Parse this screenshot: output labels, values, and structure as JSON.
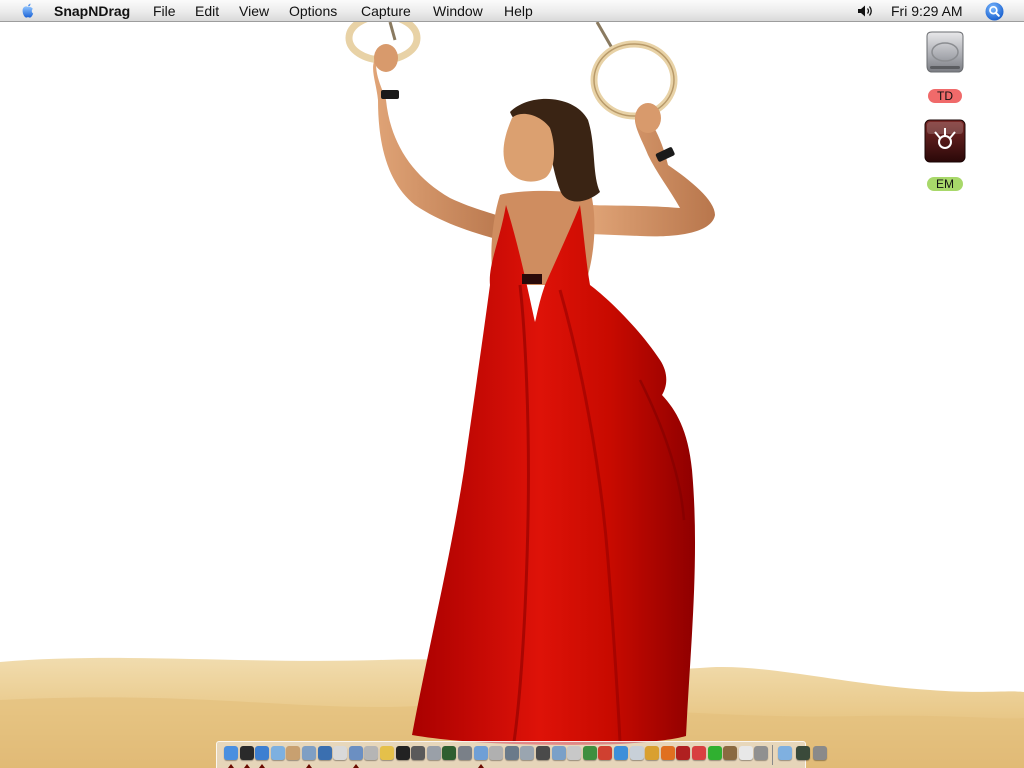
{
  "menubar": {
    "app_name": "SnapNDrag",
    "items": [
      "File",
      "Edit",
      "View",
      "Options",
      "Capture",
      "Window",
      "Help"
    ],
    "clock": "Fri 9:29 AM"
  },
  "desktop": {
    "icons": [
      {
        "label": "TD",
        "kind": "hard-drive",
        "label_color": "#f06a6a"
      },
      {
        "label": "EM",
        "kind": "firewire-drive",
        "label_color": "#a8d86a"
      }
    ]
  },
  "dock": {
    "items": [
      {
        "name": "finder",
        "color": "#4a8fe0",
        "running": true
      },
      {
        "name": "dashboard",
        "color": "#2a2a2a",
        "running": true
      },
      {
        "name": "safari",
        "color": "#3d7fd1",
        "running": true
      },
      {
        "name": "itunes",
        "color": "#7db0e0",
        "running": false
      },
      {
        "name": "iphoto",
        "color": "#c8a070",
        "running": false
      },
      {
        "name": "photo-viewer",
        "color": "#7f9fc4",
        "running": true
      },
      {
        "name": "imovie",
        "color": "#3a6fb0",
        "running": false
      },
      {
        "name": "ical",
        "color": "#d9d9d9",
        "running": false
      },
      {
        "name": "mail",
        "color": "#6b8fc2",
        "running": true
      },
      {
        "name": "address-book",
        "color": "#b5b5b5",
        "running": false
      },
      {
        "name": "script-editor",
        "color": "#e5c04a",
        "running": false
      },
      {
        "name": "terminal",
        "color": "#222222",
        "running": false
      },
      {
        "name": "activity-monitor",
        "color": "#5a5a5a",
        "running": false
      },
      {
        "name": "system-preferences",
        "color": "#9aa0a8",
        "running": false
      },
      {
        "name": "network",
        "color": "#2f5f2f",
        "running": false
      },
      {
        "name": "image-capture",
        "color": "#7a8088",
        "running": false
      },
      {
        "name": "monitor",
        "color": "#6f9fd6",
        "running": true
      },
      {
        "name": "disk-utility",
        "color": "#b0b0b0",
        "running": false
      },
      {
        "name": "text-edit",
        "color": "#6a7a8a",
        "running": false
      },
      {
        "name": "console",
        "color": "#9aa5b0",
        "running": false
      },
      {
        "name": "printer",
        "color": "#4a4a4a",
        "running": false
      },
      {
        "name": "airport",
        "color": "#7aa0c8",
        "running": false
      },
      {
        "name": "utility",
        "color": "#c8c8c8",
        "running": false
      },
      {
        "name": "keychain",
        "color": "#3f8f3f",
        "running": false
      },
      {
        "name": "calculator-app",
        "color": "#d04030",
        "running": false
      },
      {
        "name": "spotlight-app",
        "color": "#3d8fd9",
        "running": false
      },
      {
        "name": "stickies",
        "color": "#c8d0d8",
        "running": false
      },
      {
        "name": "chess",
        "color": "#d9a030",
        "running": false
      },
      {
        "name": "vlc",
        "color": "#e07020",
        "running": false
      },
      {
        "name": "dictionary",
        "color": "#b02020",
        "running": false
      },
      {
        "name": "automator",
        "color": "#d84040",
        "running": false
      },
      {
        "name": "messenger",
        "color": "#30b030",
        "running": false
      },
      {
        "name": "grapher",
        "color": "#8a6a40",
        "running": false
      },
      {
        "name": "preview",
        "color": "#e8e8e8",
        "running": false
      },
      {
        "name": "calculator",
        "color": "#909090",
        "running": false
      }
    ],
    "trailing": [
      {
        "name": "applications-folder",
        "color": "#7fb0e0"
      },
      {
        "name": "minimized-window",
        "color": "#3a4a3a"
      },
      {
        "name": "trash",
        "color": "#8a8a8a"
      }
    ]
  }
}
